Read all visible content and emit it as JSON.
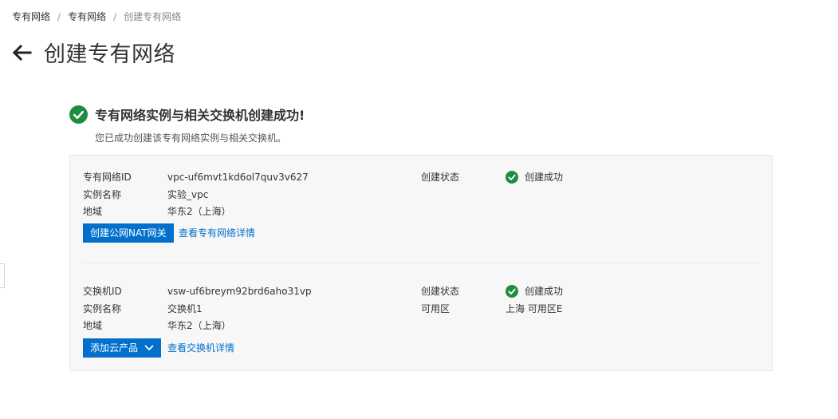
{
  "breadcrumb": {
    "items": [
      "专有网络",
      "专有网络"
    ],
    "separator": "/",
    "current": "创建专有网络"
  },
  "header": {
    "back_icon": "arrow-left-icon",
    "title": "创建专有网络"
  },
  "result": {
    "icon": "check-circle-icon",
    "title": "专有网络实例与相关交换机创建成功!",
    "subtitle": "您已成功创建该专有网络实例与相关交换机。"
  },
  "vpc": {
    "id_label": "专有网络ID",
    "id_value": "vpc-uf6mvt1kd6ol7quv3v627",
    "name_label": "实例名称",
    "name_value": "实验_vpc",
    "region_label": "地域",
    "region_value": "华东2（上海）",
    "status_label": "创建状态",
    "status_value": "创建成功",
    "create_nat_button": "创建公网NAT网关",
    "view_details_link": "查看专有网络详情"
  },
  "vswitch": {
    "id_label": "交换机ID",
    "id_value": "vsw-uf6breym92brd6aho31vp",
    "name_label": "实例名称",
    "name_value": "交换机1",
    "region_label": "地域",
    "region_value": "华东2（上海）",
    "status_label": "创建状态",
    "status_value": "创建成功",
    "zone_label": "可用区",
    "zone_value": "上海 可用区E",
    "add_product_button": "添加云产品",
    "view_details_link": "查看交换机详情"
  },
  "colors": {
    "primary": "#0070cc",
    "success": "#1e8e3e",
    "panel_bg": "#f7f7f7"
  }
}
